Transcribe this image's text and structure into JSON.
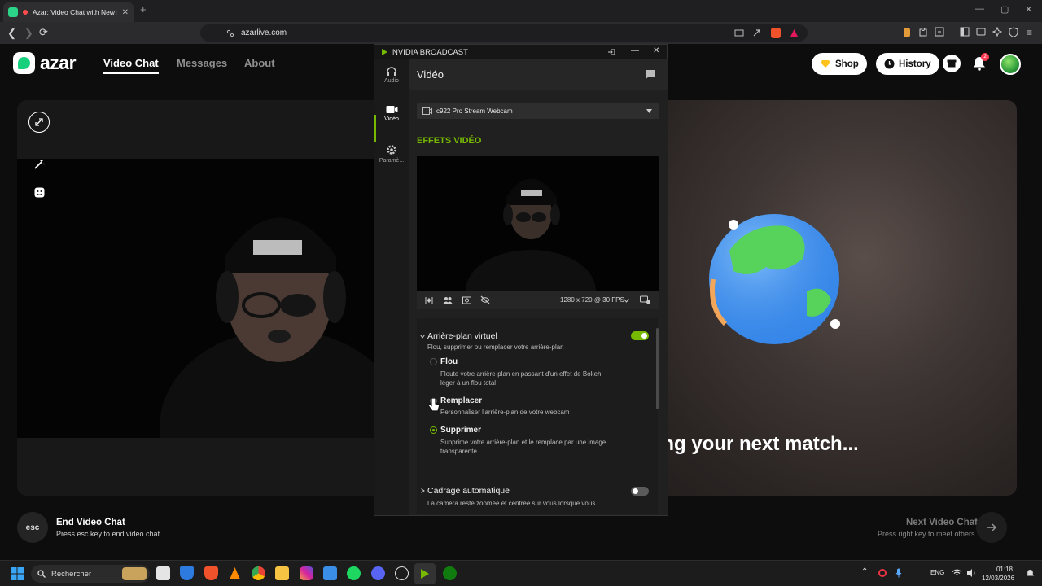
{
  "browser": {
    "tab_title": "Azar: Video Chat with New Pe",
    "tab_close": "✕",
    "new_tab": "+",
    "url": "azarlive.com",
    "window_controls": [
      "—",
      "▢",
      "✕"
    ]
  },
  "azar": {
    "logo_text": "azar",
    "nav": [
      "Video Chat",
      "Messages",
      "About"
    ],
    "shop_label": "Shop",
    "history_label": "History",
    "notification_count": "2",
    "finding_text": "ling your next match...",
    "end_title": "End Video Chat",
    "end_sub": "Press esc key to end video chat",
    "esc_label": "esc",
    "next_title": "Next Video Chat",
    "next_sub": "Press right key to meet others"
  },
  "nvidia": {
    "window_title": "NVIDIA BROADCAST",
    "sidebar": [
      {
        "label": "Audio",
        "icon": "headphones-icon"
      },
      {
        "label": "Vidéo",
        "icon": "camera-icon"
      },
      {
        "label": "Paramè...",
        "icon": "gear-icon"
      }
    ],
    "header": "Vidéo",
    "device": "c922 Pro Stream Webcam",
    "effects_title": "EFFETS VIDÉO",
    "resolution": "1280 x 720 @ 30 FPS",
    "effect_name": "Arrière-plan virtuel",
    "effect_desc": "Flou, supprimer ou remplacer votre arrière-plan",
    "options": [
      {
        "label": "Flou",
        "desc1": "Floute votre arrière-plan en passant d'un effet de Bokeh",
        "desc2": "léger à un flou total"
      },
      {
        "label": "Remplacer",
        "desc1": "Personnaliser l'arrière-plan de votre webcam",
        "desc2": ""
      },
      {
        "label": "Supprimer",
        "desc1": "Supprime votre arrière-plan et le remplace par une image",
        "desc2": "transparente"
      }
    ],
    "selected_option": "Supprimer",
    "effect2_name": "Cadrage automatique",
    "effect2_desc": "La caméra reste zoomée et centrée sur vous lorsque vous",
    "effect1_enabled": true,
    "effect2_enabled": false,
    "accent": "#76b900"
  },
  "taskbar": {
    "search_placeholder": "Rechercher",
    "lang": "ENG",
    "time": "01:18",
    "date": "12/03/2026"
  }
}
